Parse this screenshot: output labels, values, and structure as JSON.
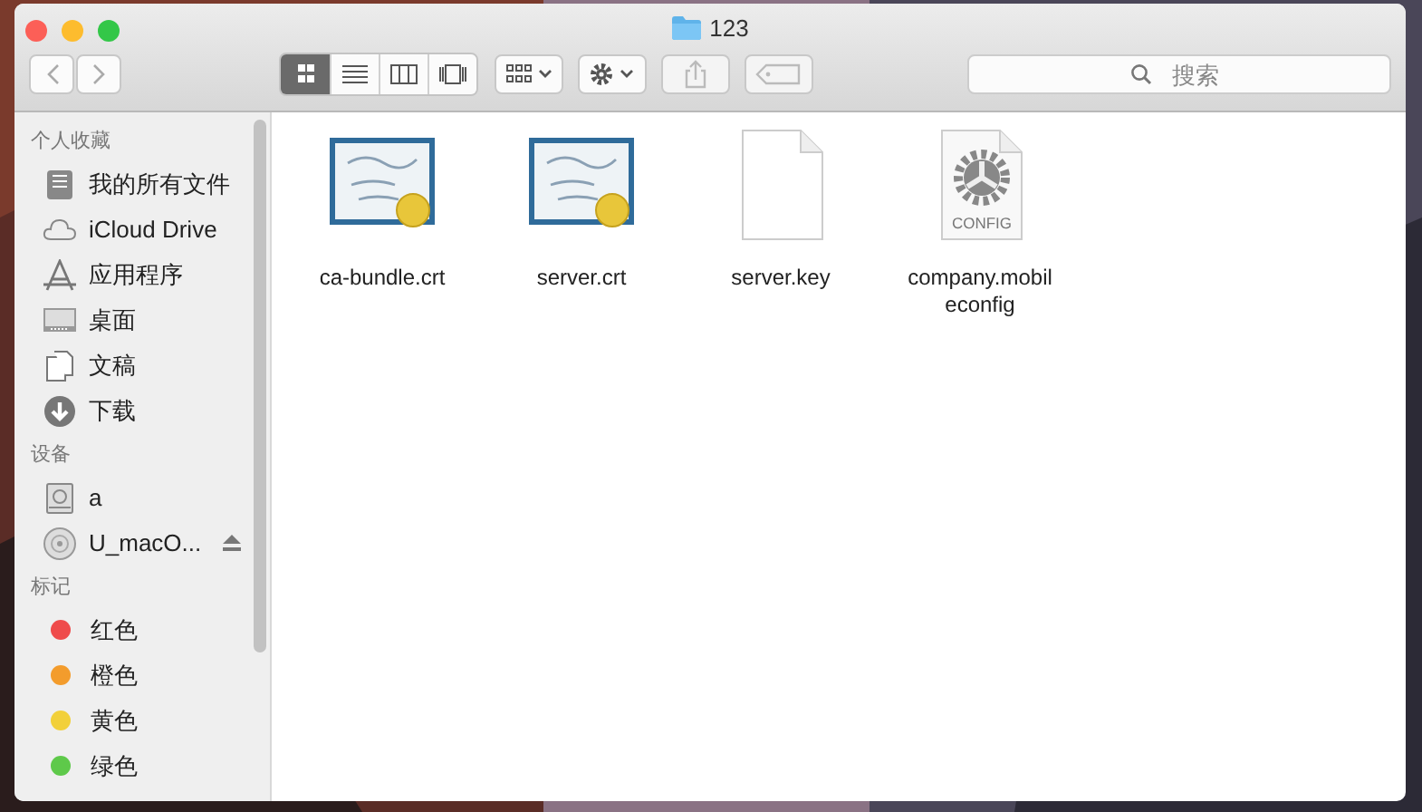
{
  "window": {
    "title": "123"
  },
  "toolbar": {
    "views": [
      {
        "kind": "icons",
        "selected": true
      },
      {
        "kind": "list",
        "selected": false
      },
      {
        "kind": "columns",
        "selected": false
      },
      {
        "kind": "coverflow",
        "selected": false
      }
    ],
    "search": {
      "placeholder": "搜索"
    }
  },
  "sidebar": {
    "sections": [
      {
        "heading": "个人收藏",
        "items": [
          {
            "kind": "allfiles",
            "label": "我的所有文件"
          },
          {
            "kind": "cloud",
            "label": "iCloud Drive"
          },
          {
            "kind": "apps",
            "label": "应用程序"
          },
          {
            "kind": "desktop",
            "label": "桌面"
          },
          {
            "kind": "documents",
            "label": "文稿"
          },
          {
            "kind": "downloads",
            "label": "下载"
          }
        ]
      },
      {
        "heading": "设备",
        "items": [
          {
            "kind": "disk",
            "label": "a"
          },
          {
            "kind": "disc",
            "label": "U_macO...",
            "eject": true
          }
        ]
      },
      {
        "heading": "标记",
        "items": [
          {
            "kind": "tag",
            "label": "红色",
            "color": "#ef4b4b"
          },
          {
            "kind": "tag",
            "label": "橙色",
            "color": "#f39c2c"
          },
          {
            "kind": "tag",
            "label": "黄色",
            "color": "#f2d03a"
          },
          {
            "kind": "tag",
            "label": "绿色",
            "color": "#5ec94a"
          }
        ]
      }
    ]
  },
  "files": [
    {
      "kind": "certificate",
      "name": "ca-bundle.crt"
    },
    {
      "kind": "certificate",
      "name": "server.crt"
    },
    {
      "kind": "blank",
      "name": "server.key"
    },
    {
      "kind": "config",
      "name": "company.mobileconfig",
      "badge": "CONFIG"
    }
  ]
}
